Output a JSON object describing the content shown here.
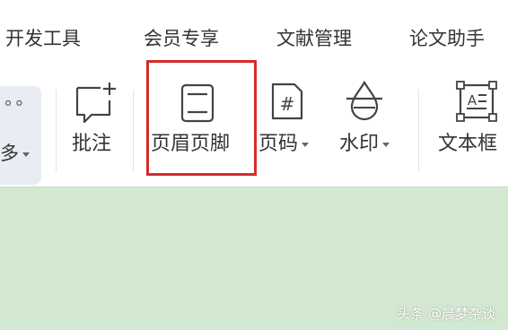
{
  "tabs": [
    "开发工具",
    "会员专享",
    "文献管理",
    "论文助手"
  ],
  "toolbar": {
    "more_label": "多",
    "comment_label": "批注",
    "header_footer_label": "页眉页脚",
    "page_number_label": "页码",
    "watermark_label": "水印",
    "textbox_label": "文本框"
  },
  "icons": {
    "more": "more-dots-icon",
    "comment": "comment-add-icon",
    "header_footer": "header-footer-icon",
    "page_number": "page-number-icon",
    "watermark": "watermark-icon",
    "textbox": "textbox-icon"
  },
  "colors": {
    "highlight": "#d42b2b",
    "background": "#d3e8d0",
    "ribbon": "#ffffff"
  },
  "watermark_text": "头条 @晨梦杂谈"
}
